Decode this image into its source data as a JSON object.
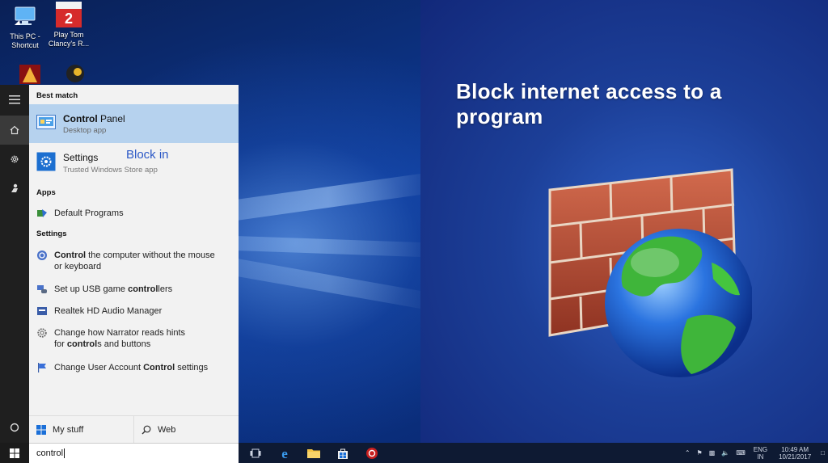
{
  "desktop": {
    "icons": [
      {
        "line1": "This PC -",
        "line2": "Shortcut"
      },
      {
        "line1": "Play Tom",
        "line2": "Clancy's R..."
      }
    ]
  },
  "promo": {
    "title": "Block internet access to a program",
    "colors": {
      "brick": "#b14a35",
      "mortar": "#e9d6c4",
      "globe": "#2b74e0",
      "land": "#3fb53a"
    }
  },
  "start_menu": {
    "sections": {
      "best_match": "Best match",
      "apps": "Apps",
      "settings": "Settings"
    },
    "best_match": {
      "bold": "Control",
      "rest": " Panel",
      "subtitle": "Desktop app"
    },
    "settings_app": {
      "title": "Settings",
      "subtitle": "Trusted Windows Store app"
    },
    "overlay_text": "Block in",
    "apps": [
      {
        "label": "Default Programs"
      }
    ],
    "settings_items": [
      {
        "bold": "Control",
        "rest": " the computer without the mouse",
        "line2": "or keyboard"
      },
      {
        "pre": "Set up USB game ",
        "bold": "control",
        "post": "lers"
      },
      {
        "label": "Realtek HD Audio Manager"
      },
      {
        "line1": "Change how Narrator reads hints",
        "pre2": "for ",
        "bold2": "control",
        "post2": "s and buttons"
      },
      {
        "pre": "Change User Account ",
        "bold": "Control",
        "post": " settings"
      }
    ],
    "tabs": {
      "my_stuff": "My stuff",
      "web": "Web"
    }
  },
  "taskbar": {
    "search_value": "control",
    "lang_line1": "ENG",
    "lang_line2": "IN",
    "time": "10:49 AM",
    "date": "10/21/2017"
  }
}
